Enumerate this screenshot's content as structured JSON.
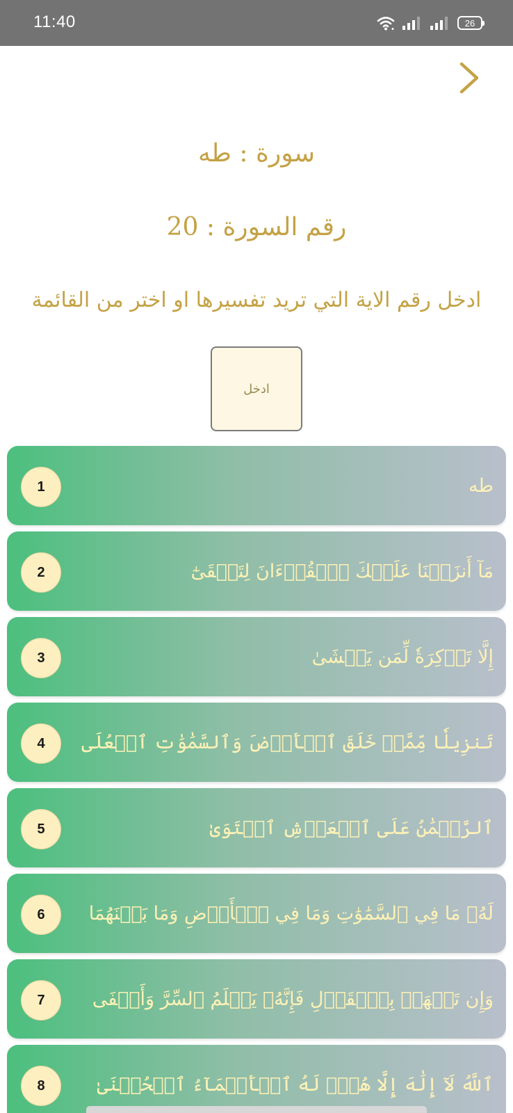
{
  "status_bar": {
    "time": "11:40",
    "battery": "26",
    "icons": [
      "wifi-icon",
      "signal-icon",
      "signal-icon",
      "battery-icon"
    ]
  },
  "header": {
    "back_icon": "chevron-right-icon",
    "surah_name": "سورة : طه",
    "surah_number": "رقم السورة : 20",
    "instruction": "ادخل رقم الاية التي تريد تفسيرها او اختر من القائمة"
  },
  "input": {
    "placeholder": "ادخل",
    "value": ""
  },
  "ayahs": [
    {
      "number": "1",
      "text": "طه"
    },
    {
      "number": "2",
      "text": "مَآ أَنزَلۡنَا عَلَيۡكَ ٱلۡقُرۡءَانَ لِتَشۡقَىٰٓ"
    },
    {
      "number": "3",
      "text": "إِلَّا تَذۡكِرَةٗ لِّمَن يَخۡشَىٰ"
    },
    {
      "number": "4",
      "text": "تَنزِيلٗا مِّمَّنۡ خَلَقَ ٱلۡأَرۡضَ وَٱلسَّمَٰوَٰتِ ٱلۡعُلَى"
    },
    {
      "number": "5",
      "text": "ٱلرَّحۡمَٰنُ عَلَى ٱلۡعَرۡشِ ٱسۡتَوَىٰ"
    },
    {
      "number": "6",
      "text": "لَهُۥ مَا فِي ٱلسَّمَٰوَٰتِ وَمَا فِي ٱلۡأَرۡضِ وَمَا بَيۡنَهُمَا"
    },
    {
      "number": "7",
      "text": "وَإِن تَجۡهَرۡ بِٱلۡقَوۡلِ فَإِنَّهُۥ يَعۡلَمُ ٱلسِّرَّ وَأَخۡفَى"
    },
    {
      "number": "8",
      "text": "ٱللَّهُ لَآ إِلَٰهَ إِلَّا هُوَۖ لَهُ ٱلۡأَسۡمَآءُ ٱلۡحُسۡنَىٰ"
    }
  ],
  "colors": {
    "accent_gold": "#c4a245",
    "card_gradient_start": "#4cbf7e",
    "card_gradient_end": "#b8bfcb",
    "badge_fill": "#fdefc0",
    "ayah_text": "#fdf1b6",
    "status_bar": "#737373"
  }
}
